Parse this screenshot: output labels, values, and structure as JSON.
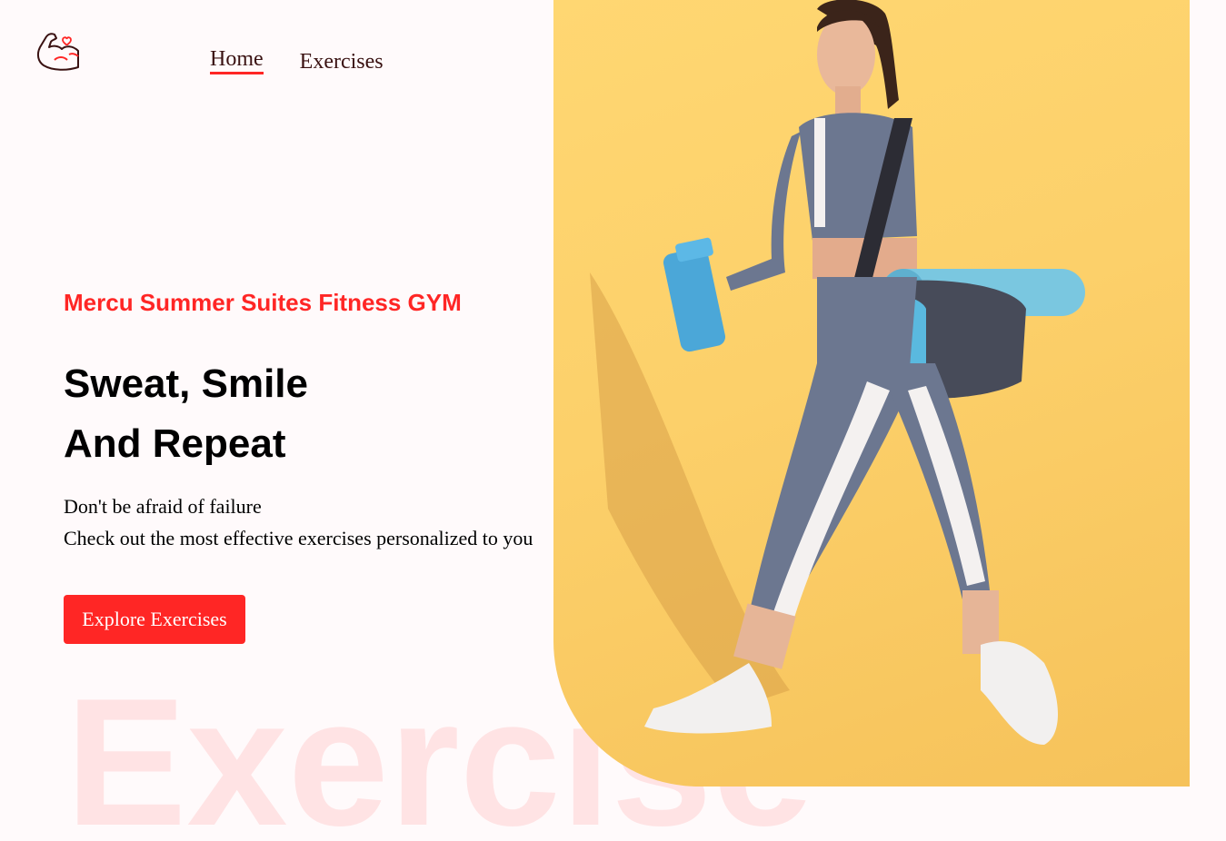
{
  "nav": {
    "home_label": "Home",
    "exercises_label": "Exercises"
  },
  "hero": {
    "gym_name": "Mercu Summer Suites Fitness GYM",
    "headline_line1": "Sweat, Smile",
    "headline_line2": "And Repeat",
    "subtext_line1": "Don't be afraid of failure",
    "subtext_line2": "Check out the most effective exercises personalized to you",
    "cta_label": "Explore Exercises",
    "watermark": "Exercise"
  },
  "icons": {
    "logo": "flexed-arm-heart-icon"
  },
  "colors": {
    "accent": "#ff2625",
    "background": "#fffafb",
    "hero_bg": "#fcd06a"
  }
}
